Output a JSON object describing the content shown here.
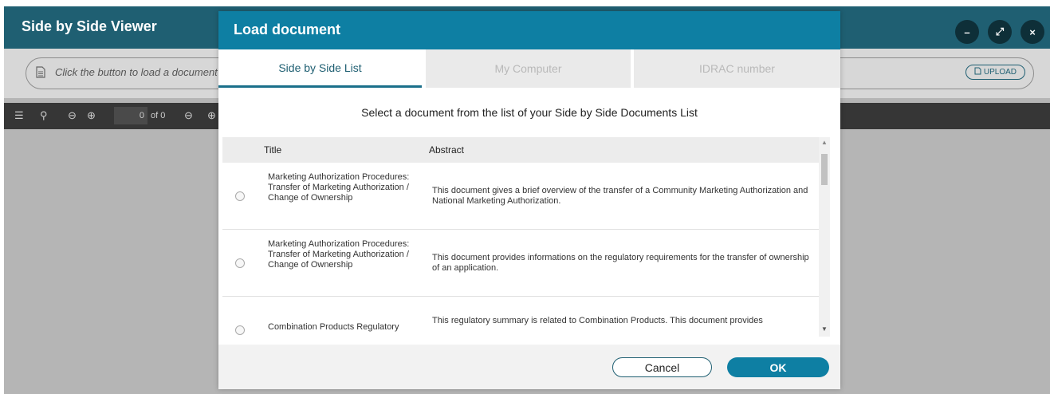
{
  "app": {
    "title": "Side by Side Viewer",
    "window_controls": {
      "minimize": "–",
      "expand": "⤢",
      "close": "×"
    },
    "load_bar": {
      "placeholder": "Click the button to load a document",
      "upload_label": "UPLOAD"
    },
    "toolbar": {
      "page_value": "0",
      "page_of": "of 0"
    }
  },
  "modal": {
    "title": "Load document",
    "tabs": [
      {
        "label": "Side by Side List",
        "active": true
      },
      {
        "label": "My Computer",
        "active": false
      },
      {
        "label": "IDRAC number",
        "active": false
      }
    ],
    "instruction": "Select a document from the list of your Side by Side Documents List",
    "columns": {
      "title": "Title",
      "abstract": "Abstract"
    },
    "rows": [
      {
        "title": "Marketing Authorization Procedures: Transfer of Marketing Authorization / Change of Ownership",
        "abstract": "This document gives a brief overview of the transfer of a Community Marketing Authorization and National Marketing Authorization."
      },
      {
        "title": "Marketing Authorization Procedures: Transfer of Marketing Authorization / Change of Ownership",
        "abstract": "This document provides informations on the regulatory requirements for the transfer of ownership of an application."
      },
      {
        "title": "Combination Products Regulatory",
        "abstract": "This regulatory summary is related to Combination Products. This document provides"
      }
    ],
    "buttons": {
      "cancel": "Cancel",
      "ok": "OK"
    }
  },
  "colors": {
    "header_dark": "#1f5f72",
    "modal_header": "#0e7fa3",
    "primary_button": "#0e7fa3",
    "backdrop_gray": "#b5b5b5",
    "toolbar": "#363636"
  }
}
